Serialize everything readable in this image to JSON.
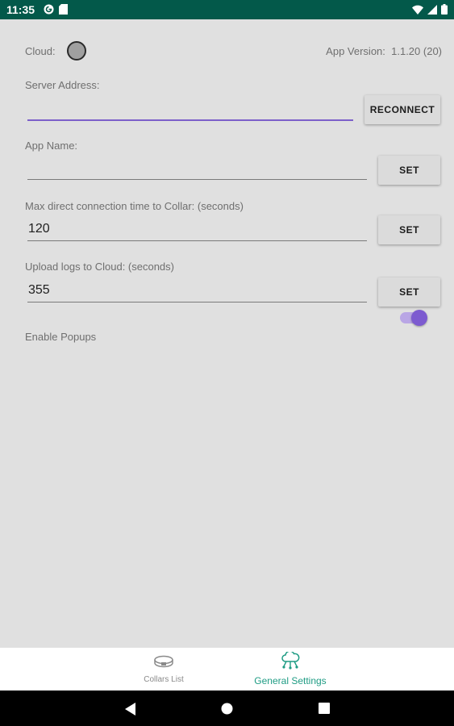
{
  "status_bar": {
    "time": "11:35",
    "left_icons": [
      "notification-g-icon",
      "sd-card-icon"
    ],
    "right_icons": [
      "wifi-icon",
      "signal-icon",
      "battery-icon"
    ],
    "background": "#03594a"
  },
  "header": {
    "cloud_label": "Cloud:",
    "cloud_status_color": "#a0a0a0",
    "app_version_label": "App Version:",
    "app_version_value": "1.1.20 (20)"
  },
  "server": {
    "label": "Server Address:",
    "value": "",
    "button_label": "RECONNECT"
  },
  "app_name": {
    "label": "App Name:",
    "value": "",
    "button_label": "SET"
  },
  "max_connection": {
    "label": "Max direct connection time to Collar: (seconds)",
    "value": "120",
    "button_label": "SET"
  },
  "upload_logs": {
    "label": "Upload logs to Cloud: (seconds)",
    "value": "355",
    "button_label": "SET"
  },
  "popups": {
    "label": "Enable Popups",
    "enabled": true,
    "accent_color": "#7d5bd0"
  },
  "bottom_nav": {
    "items": [
      {
        "label": "Collars List",
        "icon": "collar-icon",
        "active": false
      },
      {
        "label": "General Settings",
        "icon": "cloud-network-icon",
        "active": true
      }
    ],
    "active_color": "#1f9c84"
  },
  "system_nav": {
    "icons": [
      "back-icon",
      "home-icon",
      "recents-icon"
    ]
  }
}
